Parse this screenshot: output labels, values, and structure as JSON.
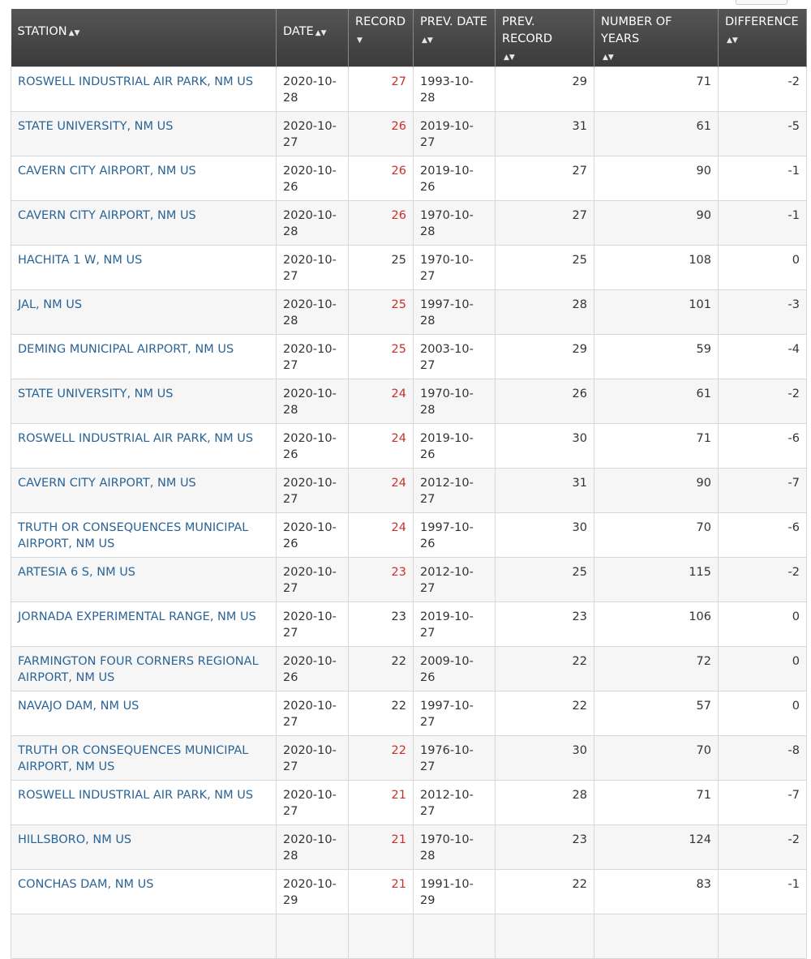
{
  "columns": [
    {
      "label": "STATION",
      "sort_icon": "sort-icon"
    },
    {
      "label": "DATE",
      "sort_icon": "sort-icon"
    },
    {
      "label": "RECORD",
      "sort_icon": "sort-desc-icon"
    },
    {
      "label": "PREV. DATE",
      "sort_icon": "sort-icon"
    },
    {
      "label": "PREV. RECORD",
      "sort_icon": "sort-icon"
    },
    {
      "label": "NUMBER OF YEARS",
      "sort_icon": "sort-icon"
    },
    {
      "label": "DIFFERENCE",
      "sort_icon": "sort-icon"
    }
  ],
  "colors": {
    "header_bg": "#444444",
    "link": "#2a6496",
    "record_highlight": "#c9302c",
    "row_alt": "#f6f6f6"
  },
  "rows": [
    {
      "station": "ROSWELL INDUSTRIAL AIR PARK, NM US",
      "date": "2020-10-28",
      "record": "27",
      "highlight": true,
      "prev_date": "1993-10-28",
      "prev_record": "29",
      "years": "71",
      "difference": "-2"
    },
    {
      "station": "STATE UNIVERSITY, NM US",
      "date": "2020-10-27",
      "record": "26",
      "highlight": true,
      "prev_date": "2019-10-27",
      "prev_record": "31",
      "years": "61",
      "difference": "-5"
    },
    {
      "station": "CAVERN CITY AIRPORT, NM US",
      "date": "2020-10-26",
      "record": "26",
      "highlight": true,
      "prev_date": "2019-10-26",
      "prev_record": "27",
      "years": "90",
      "difference": "-1"
    },
    {
      "station": "CAVERN CITY AIRPORT, NM US",
      "date": "2020-10-28",
      "record": "26",
      "highlight": true,
      "prev_date": "1970-10-28",
      "prev_record": "27",
      "years": "90",
      "difference": "-1"
    },
    {
      "station": "HACHITA 1 W, NM US",
      "date": "2020-10-27",
      "record": "25",
      "highlight": false,
      "prev_date": "1970-10-27",
      "prev_record": "25",
      "years": "108",
      "difference": "0"
    },
    {
      "station": "JAL, NM US",
      "date": "2020-10-28",
      "record": "25",
      "highlight": true,
      "prev_date": "1997-10-28",
      "prev_record": "28",
      "years": "101",
      "difference": "-3"
    },
    {
      "station": "DEMING MUNICIPAL AIRPORT, NM US",
      "date": "2020-10-27",
      "record": "25",
      "highlight": true,
      "prev_date": "2003-10-27",
      "prev_record": "29",
      "years": "59",
      "difference": "-4"
    },
    {
      "station": "STATE UNIVERSITY, NM US",
      "date": "2020-10-28",
      "record": "24",
      "highlight": true,
      "prev_date": "1970-10-28",
      "prev_record": "26",
      "years": "61",
      "difference": "-2"
    },
    {
      "station": "ROSWELL INDUSTRIAL AIR PARK, NM US",
      "date": "2020-10-26",
      "record": "24",
      "highlight": true,
      "prev_date": "2019-10-26",
      "prev_record": "30",
      "years": "71",
      "difference": "-6"
    },
    {
      "station": "CAVERN CITY AIRPORT, NM US",
      "date": "2020-10-27",
      "record": "24",
      "highlight": true,
      "prev_date": "2012-10-27",
      "prev_record": "31",
      "years": "90",
      "difference": "-7"
    },
    {
      "station": "TRUTH OR CONSEQUENCES MUNICIPAL AIRPORT, NM US",
      "date": "2020-10-26",
      "record": "24",
      "highlight": true,
      "prev_date": "1997-10-26",
      "prev_record": "30",
      "years": "70",
      "difference": "-6"
    },
    {
      "station": "ARTESIA 6 S, NM US",
      "date": "2020-10-27",
      "record": "23",
      "highlight": true,
      "prev_date": "2012-10-27",
      "prev_record": "25",
      "years": "115",
      "difference": "-2"
    },
    {
      "station": "JORNADA EXPERIMENTAL RANGE, NM US",
      "date": "2020-10-27",
      "record": "23",
      "highlight": false,
      "prev_date": "2019-10-27",
      "prev_record": "23",
      "years": "106",
      "difference": "0"
    },
    {
      "station": "FARMINGTON FOUR CORNERS REGIONAL AIRPORT, NM US",
      "date": "2020-10-26",
      "record": "22",
      "highlight": false,
      "prev_date": "2009-10-26",
      "prev_record": "22",
      "years": "72",
      "difference": "0"
    },
    {
      "station": "NAVAJO DAM, NM US",
      "date": "2020-10-27",
      "record": "22",
      "highlight": false,
      "prev_date": "1997-10-27",
      "prev_record": "22",
      "years": "57",
      "difference": "0"
    },
    {
      "station": "TRUTH OR CONSEQUENCES MUNICIPAL AIRPORT, NM US",
      "date": "2020-10-27",
      "record": "22",
      "highlight": true,
      "prev_date": "1976-10-27",
      "prev_record": "30",
      "years": "70",
      "difference": "-8"
    },
    {
      "station": "ROSWELL INDUSTRIAL AIR PARK, NM US",
      "date": "2020-10-27",
      "record": "21",
      "highlight": true,
      "prev_date": "2012-10-27",
      "prev_record": "28",
      "years": "71",
      "difference": "-7"
    },
    {
      "station": "HILLSBORO, NM US",
      "date": "2020-10-28",
      "record": "21",
      "highlight": true,
      "prev_date": "1970-10-28",
      "prev_record": "23",
      "years": "124",
      "difference": "-2"
    },
    {
      "station": "CONCHAS DAM, NM US",
      "date": "2020-10-29",
      "record": "21",
      "highlight": true,
      "prev_date": "1991-10-29",
      "prev_record": "22",
      "years": "83",
      "difference": "-1"
    },
    {
      "station": "",
      "date": "",
      "record": "",
      "highlight": false,
      "prev_date": "",
      "prev_record": "",
      "years": "",
      "difference": ""
    }
  ]
}
